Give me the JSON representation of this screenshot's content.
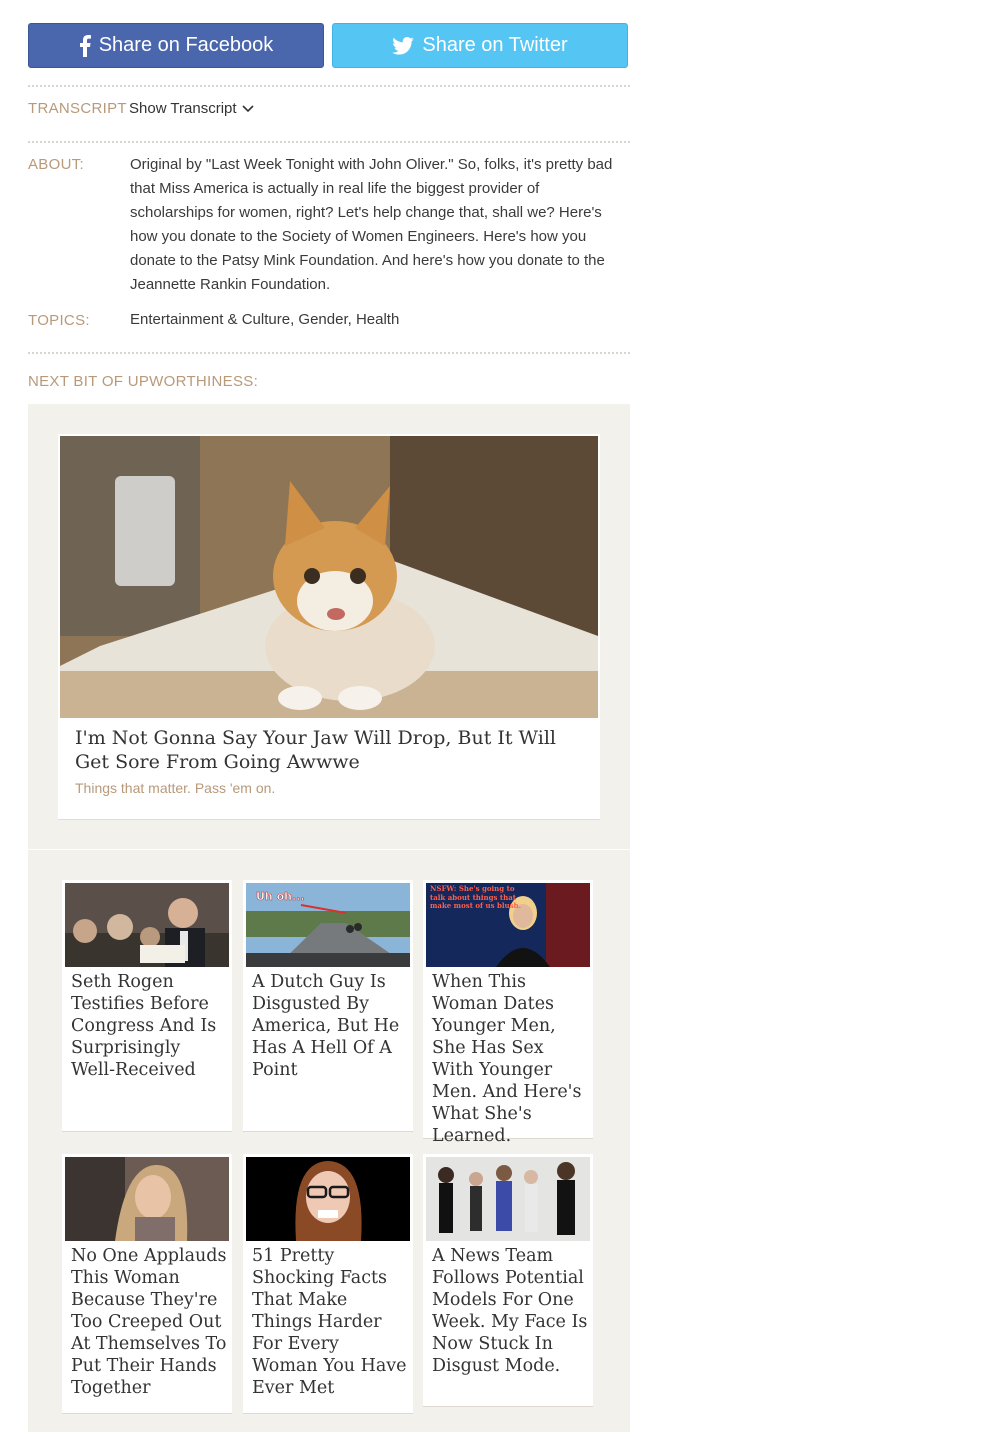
{
  "share": {
    "facebook_label": "Share on Facebook",
    "twitter_label": "Share on Twitter",
    "facebook_color": "#4a66ad",
    "twitter_color": "#55c5f3"
  },
  "transcript": {
    "label": "TRANSCRIPT",
    "toggle_label": "Show Transcript"
  },
  "about": {
    "label": "ABOUT:",
    "text": "Original by \"Last Week Tonight with John Oliver.\" So, folks, it's pretty bad that Miss America is actually in real life the biggest provider of scholarships for women, right? Let's help change that, shall we? Here's how you donate to the Society of Women Engineers. Here's how you donate to the Patsy Mink Foundation. And here's how you donate to the Jeannette Rankin Foundation."
  },
  "topics": {
    "label": "TOPICS:",
    "text": "Entertainment & Culture, Gender, Health"
  },
  "next": {
    "label": "NEXT BIT OF UPWORTHINESS:",
    "feature": {
      "title": "I'm Not Gonna Say Your Jaw Will Drop, But It Will Get Sore From Going Awwwe",
      "tagline": "Things that matter. Pass 'em on.",
      "image_icon": "kitten-photo"
    },
    "items": [
      {
        "title": "Seth Rogen Testifies Before Congress And Is Surprisingly Well-Received"
      },
      {
        "title": "A Dutch Guy Is Disgusted By America, But He Has A Hell Of A Point",
        "thumb_caption": "Uh oh..."
      },
      {
        "title": "When This Woman Dates Younger Men, She Has Sex With Younger Men. And Here's What She's Learned.",
        "thumb_caption": "NSFW: She's going to talk about things that make most of us blush."
      },
      {
        "title": "No One Applauds This Woman Because They're Too Creeped Out At Themselves To Put Their Hands Together"
      },
      {
        "title": "51 Pretty Shocking Facts That Make Things Harder For Every Woman You Have Ever Met"
      },
      {
        "title": "A News Team Follows Potential Models For One Week. My Face Is Now Stuck In Disgust Mode."
      }
    ]
  }
}
